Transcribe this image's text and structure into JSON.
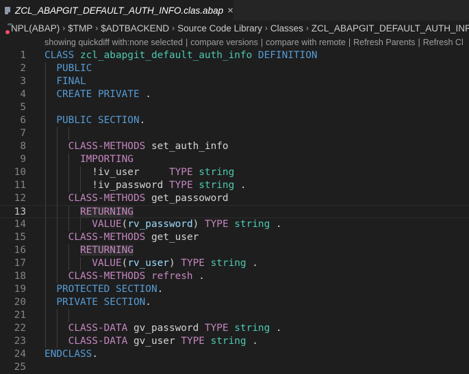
{
  "tab": {
    "icon": "file-icon",
    "title": "ZCL_ABAPGIT_DEFAULT_AUTH_INFO.clas.abap",
    "close": "×"
  },
  "breadcrumb": {
    "items": [
      "NPL(ABAP)",
      "$TMP",
      "$ADTBACKEND",
      "Source Code Library",
      "Classes",
      "ZCL_ABAPGIT_DEFAULT_AUTH_INFO"
    ],
    "separator": "›"
  },
  "codelens": {
    "items": [
      "showing quickdiff with:none selected",
      "compare versions",
      "compare with remote",
      "Refresh Parents",
      "Refresh Cl"
    ],
    "separator": "|"
  },
  "editor": {
    "current_line": 13,
    "lines": [
      {
        "n": "1",
        "tokens": [
          {
            "t": "CLASS ",
            "c": "kw"
          },
          {
            "t": "zcl_abapgit_default_auth_info",
            "c": "cls"
          },
          {
            "t": " DEFINITION",
            "c": "kw"
          }
        ]
      },
      {
        "n": "2",
        "tokens": [
          {
            "t": "  PUBLIC",
            "c": "kw"
          }
        ]
      },
      {
        "n": "3",
        "tokens": [
          {
            "t": "  FINAL",
            "c": "kw"
          }
        ]
      },
      {
        "n": "4",
        "tokens": [
          {
            "t": "  CREATE PRIVATE",
            "c": "kw"
          },
          {
            "t": " .",
            "c": "plain"
          }
        ]
      },
      {
        "n": "5",
        "tokens": []
      },
      {
        "n": "6",
        "tokens": [
          {
            "t": "  PUBLIC SECTION",
            "c": "kw"
          },
          {
            "t": ".",
            "c": "plain"
          }
        ]
      },
      {
        "n": "7",
        "tokens": []
      },
      {
        "n": "8",
        "tokens": [
          {
            "t": "    CLASS-METHODS",
            "c": "kw2"
          },
          {
            "t": " set_auth_info",
            "c": "plain"
          }
        ]
      },
      {
        "n": "9",
        "tokens": [
          {
            "t": "      IMPORTING",
            "c": "kw2"
          }
        ]
      },
      {
        "n": "10",
        "tokens": [
          {
            "t": "        !iv_user     ",
            "c": "plain"
          },
          {
            "t": "TYPE",
            "c": "kw2"
          },
          {
            "t": " string",
            "c": "typ"
          }
        ]
      },
      {
        "n": "11",
        "tokens": [
          {
            "t": "        !iv_password ",
            "c": "plain"
          },
          {
            "t": "TYPE",
            "c": "kw2"
          },
          {
            "t": " string",
            "c": "typ"
          },
          {
            "t": " .",
            "c": "plain"
          }
        ]
      },
      {
        "n": "12",
        "tokens": [
          {
            "t": "    CLASS-METHODS",
            "c": "kw2"
          },
          {
            "t": " get_passoword",
            "c": "plain"
          }
        ]
      },
      {
        "n": "13",
        "tokens": [
          {
            "t": "      ",
            "c": "plain"
          },
          {
            "t": "RETURNING",
            "c": "kw2 hl-word"
          }
        ]
      },
      {
        "n": "14",
        "tokens": [
          {
            "t": "        VALUE",
            "c": "kw2"
          },
          {
            "t": "(",
            "c": "plain"
          },
          {
            "t": "rv_password",
            "c": "var"
          },
          {
            "t": ") ",
            "c": "plain"
          },
          {
            "t": "TYPE",
            "c": "kw2"
          },
          {
            "t": " string",
            "c": "typ"
          },
          {
            "t": " .",
            "c": "plain"
          }
        ]
      },
      {
        "n": "15",
        "tokens": [
          {
            "t": "    CLASS-METHODS",
            "c": "kw2"
          },
          {
            "t": " get_user",
            "c": "plain"
          }
        ]
      },
      {
        "n": "16",
        "tokens": [
          {
            "t": "      ",
            "c": "plain"
          },
          {
            "t": "RETURNING",
            "c": "kw2 hl-word"
          }
        ]
      },
      {
        "n": "17",
        "tokens": [
          {
            "t": "        VALUE",
            "c": "kw2"
          },
          {
            "t": "(",
            "c": "plain"
          },
          {
            "t": "rv_user",
            "c": "var"
          },
          {
            "t": ") ",
            "c": "plain"
          },
          {
            "t": "TYPE",
            "c": "kw2"
          },
          {
            "t": " string",
            "c": "typ"
          },
          {
            "t": " .",
            "c": "plain"
          }
        ]
      },
      {
        "n": "18",
        "tokens": [
          {
            "t": "    CLASS-METHODS refresh",
            "c": "kw2"
          },
          {
            "t": " .",
            "c": "plain"
          }
        ]
      },
      {
        "n": "19",
        "tokens": [
          {
            "t": "  PROTECTED SECTION",
            "c": "kw"
          },
          {
            "t": ".",
            "c": "plain"
          }
        ]
      },
      {
        "n": "20",
        "tokens": [
          {
            "t": "  PRIVATE SECTION",
            "c": "kw"
          },
          {
            "t": ".",
            "c": "plain"
          }
        ]
      },
      {
        "n": "21",
        "tokens": []
      },
      {
        "n": "22",
        "tokens": [
          {
            "t": "    CLASS-DATA",
            "c": "kw2"
          },
          {
            "t": " gv_password ",
            "c": "plain"
          },
          {
            "t": "TYPE",
            "c": "kw2"
          },
          {
            "t": " string",
            "c": "typ"
          },
          {
            "t": " .",
            "c": "plain"
          }
        ]
      },
      {
        "n": "23",
        "tokens": [
          {
            "t": "    CLASS-DATA",
            "c": "kw2"
          },
          {
            "t": " gv_user ",
            "c": "plain"
          },
          {
            "t": "TYPE",
            "c": "kw2"
          },
          {
            "t": " string",
            "c": "typ"
          },
          {
            "t": " .",
            "c": "plain"
          }
        ]
      },
      {
        "n": "24",
        "tokens": [
          {
            "t": "ENDCLASS",
            "c": "kw"
          },
          {
            "t": ".",
            "c": "plain"
          }
        ]
      },
      {
        "n": "25",
        "tokens": []
      }
    ],
    "indent_guides": {
      "2": [
        0
      ],
      "3": [
        0
      ],
      "4": [
        0
      ],
      "5": [
        0
      ],
      "6": [
        0
      ],
      "7": [
        0,
        1,
        2
      ],
      "8": [
        0,
        1
      ],
      "9": [
        0,
        1,
        2
      ],
      "10": [
        0,
        1,
        2,
        3
      ],
      "11": [
        0,
        1,
        2,
        3
      ],
      "12": [
        0,
        1
      ],
      "13": [
        0,
        1,
        2
      ],
      "14": [
        0,
        1,
        2,
        3
      ],
      "15": [
        0,
        1
      ],
      "16": [
        0,
        1,
        2
      ],
      "17": [
        0,
        1,
        2,
        3
      ],
      "18": [
        0,
        1
      ],
      "19": [
        0
      ],
      "20": [
        0
      ],
      "21": [
        0,
        1,
        2
      ],
      "22": [
        0,
        1
      ],
      "23": [
        0,
        1
      ]
    }
  }
}
